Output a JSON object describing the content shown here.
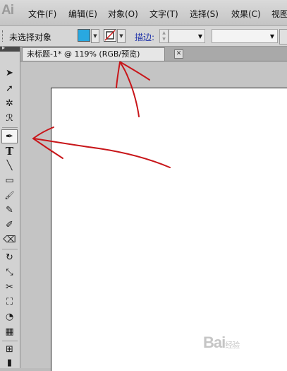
{
  "app": {
    "logo": "Ai"
  },
  "menu": [
    {
      "label": "文件(F)"
    },
    {
      "label": "编辑(E)"
    },
    {
      "label": "对象(O)"
    },
    {
      "label": "文字(T)"
    },
    {
      "label": "选择(S)"
    },
    {
      "label": "效果(C)"
    },
    {
      "label": "视图"
    }
  ],
  "control_bar": {
    "selection_status": "未选择对象",
    "fill_color": "#29a8e0",
    "stroke_label": "描边:",
    "stroke_weight": "",
    "profile": ""
  },
  "document": {
    "tab_title": "未标题-1* @ 119% (RGB/预览)",
    "close_glyph": "✕"
  },
  "tools": [
    {
      "name": "selection-tool",
      "glyph": "➤"
    },
    {
      "name": "direct-selection-tool",
      "glyph": "➚"
    },
    {
      "name": "magic-wand-tool",
      "glyph": "✲"
    },
    {
      "name": "lasso-tool",
      "glyph": "ℛ"
    },
    {
      "name": "pen-tool",
      "glyph": "✒"
    },
    {
      "name": "type-tool",
      "glyph": "T"
    },
    {
      "name": "line-tool",
      "glyph": "╲"
    },
    {
      "name": "rectangle-tool",
      "glyph": "▭"
    },
    {
      "name": "paintbrush-tool",
      "glyph": "🖌"
    },
    {
      "name": "pencil-tool",
      "glyph": "✎"
    },
    {
      "name": "blob-brush-tool",
      "glyph": "✐"
    },
    {
      "name": "eraser-tool",
      "glyph": "⌫"
    },
    {
      "name": "rotate-tool",
      "glyph": "↻"
    },
    {
      "name": "scale-tool",
      "glyph": "⤡"
    },
    {
      "name": "width-tool",
      "glyph": "✂"
    },
    {
      "name": "free-transform-tool",
      "glyph": "⛶"
    },
    {
      "name": "shape-builder-tool",
      "glyph": "◔"
    },
    {
      "name": "perspective-grid-tool",
      "glyph": "▦"
    },
    {
      "name": "mesh-tool",
      "glyph": "⊞"
    },
    {
      "name": "gradient-tool",
      "glyph": "▮"
    }
  ],
  "watermark": {
    "text": "Bai",
    "suffix": "经验"
  }
}
